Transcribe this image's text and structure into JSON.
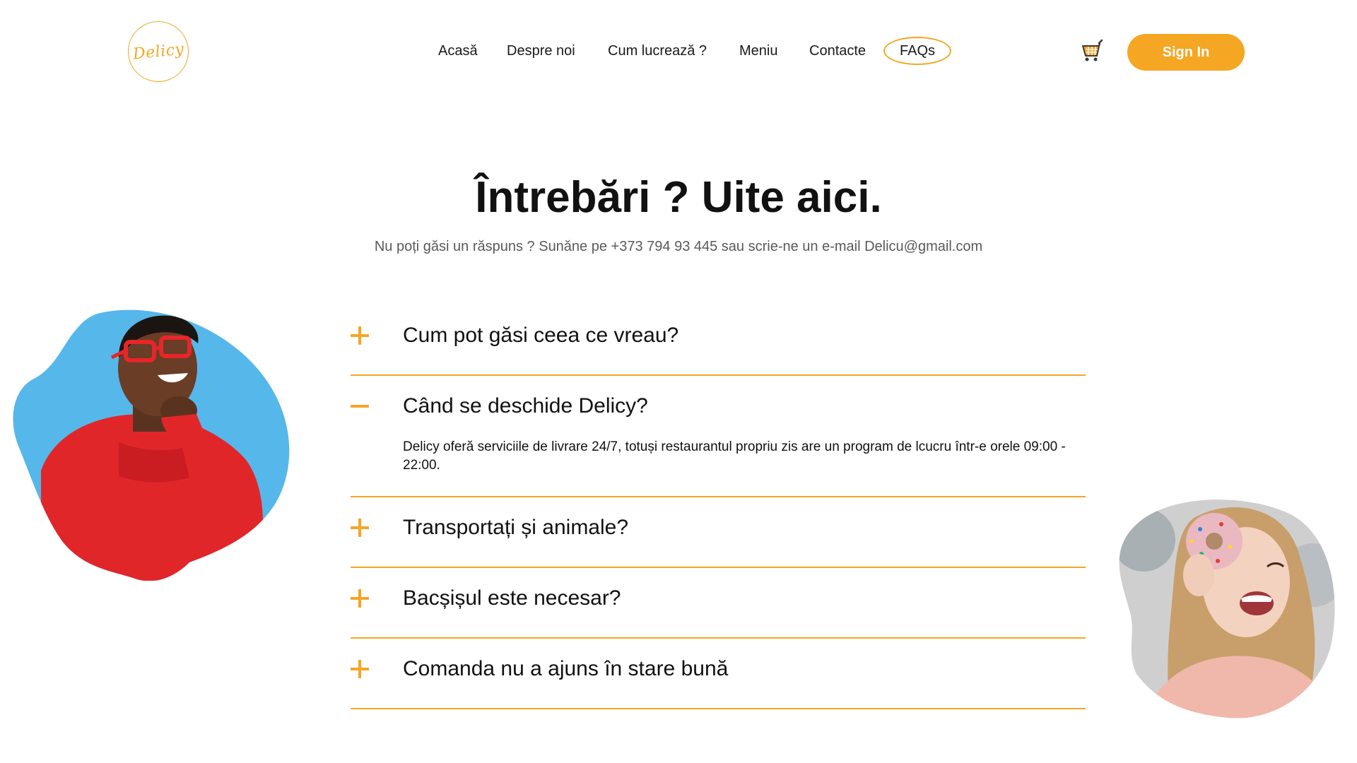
{
  "header": {
    "logo_text": "Delicy",
    "nav": [
      {
        "label": "Acasă",
        "active": false
      },
      {
        "label": "Despre noi",
        "active": false
      },
      {
        "label": "Cum lucrează ?",
        "active": false
      },
      {
        "label": "Meniu",
        "active": false
      },
      {
        "label": "Contacte",
        "active": false
      },
      {
        "label": "FAQs",
        "active": true
      }
    ],
    "signin_label": "Sign In",
    "cart_icon": "shopping-cart-icon"
  },
  "hero": {
    "title": "Întrebări ? Uite aici.",
    "subtitle": "Nu poți găsi un răspuns ?  Sunăne pe +373 794 93 445 sau scrie-ne un e-mail Delicu@gmail.com"
  },
  "faq": [
    {
      "question": "Cum pot găsi ceea ce vreau?",
      "expanded": false,
      "answer": ""
    },
    {
      "question": "Când se deschide Delicy?",
      "expanded": true,
      "answer": "Delicy oferă serviciile de livrare 24/7, totuși restaurantul propriu zis are un program de lcucru într-e orele 09:00 - 22:00."
    },
    {
      "question": "Transportați și animale?",
      "expanded": false,
      "answer": ""
    },
    {
      "question": "Bacșișul este necesar?",
      "expanded": false,
      "answer": ""
    },
    {
      "question": "Comanda nu a ajuns în stare bună",
      "expanded": false,
      "answer": ""
    }
  ],
  "colors": {
    "accent": "#f5a623",
    "text": "#111111",
    "muted": "#5a5a5a"
  }
}
